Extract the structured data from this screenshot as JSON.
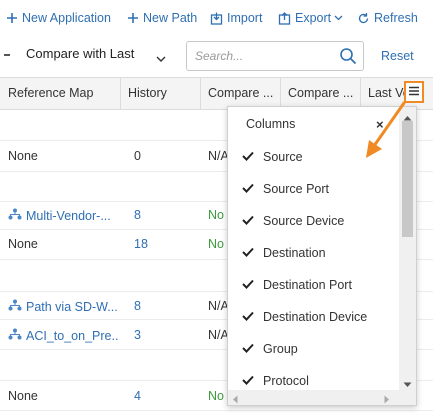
{
  "toolbar": {
    "new_application": "New Application",
    "new_path": "New Path",
    "import": "Import",
    "export": "Export",
    "refresh": "Refresh"
  },
  "filter": {
    "compare_selected": "Compare with Last",
    "search_placeholder": "Search...",
    "reset": "Reset"
  },
  "columns": {
    "reference_map": "Reference Map",
    "history": "History",
    "compare1": "Compare ...",
    "compare2": "Compare ...",
    "last_ver": "Last Ve"
  },
  "rows": [
    {
      "ref": "None",
      "history": "0",
      "compare": "N/A",
      "ref_link": false,
      "history_link": false,
      "compare_no": false
    },
    {
      "ref": "Multi-Vendor-...",
      "history": "8",
      "compare": "No",
      "ref_link": true,
      "history_link": true,
      "compare_no": true
    },
    {
      "ref": "None",
      "history": "18",
      "compare": "No",
      "ref_link": false,
      "history_link": true,
      "compare_no": true
    },
    {
      "ref": "Path via SD-W...",
      "history": "8",
      "compare": "N/A",
      "ref_link": true,
      "history_link": true,
      "compare_no": false
    },
    {
      "ref": "ACI_to_on_Pre...",
      "history": "3",
      "compare": "N/A",
      "ref_link": true,
      "history_link": true,
      "compare_no": false
    },
    {
      "ref": "None",
      "history": "4",
      "compare": "No",
      "ref_link": false,
      "history_link": true,
      "compare_no": true
    }
  ],
  "column_menu": {
    "title": "Columns",
    "close": "×",
    "items": [
      {
        "label": "Source",
        "checked": true
      },
      {
        "label": "Source Port",
        "checked": true
      },
      {
        "label": "Source Device",
        "checked": true
      },
      {
        "label": "Destination",
        "checked": true
      },
      {
        "label": "Destination Port",
        "checked": true
      },
      {
        "label": "Destination Device",
        "checked": true
      },
      {
        "label": "Group",
        "checked": true
      },
      {
        "label": "Protocol",
        "checked": true
      }
    ]
  },
  "colors": {
    "link": "#2f6fb3",
    "accent": "#f08a24",
    "status_no": "#3d9a3d"
  }
}
